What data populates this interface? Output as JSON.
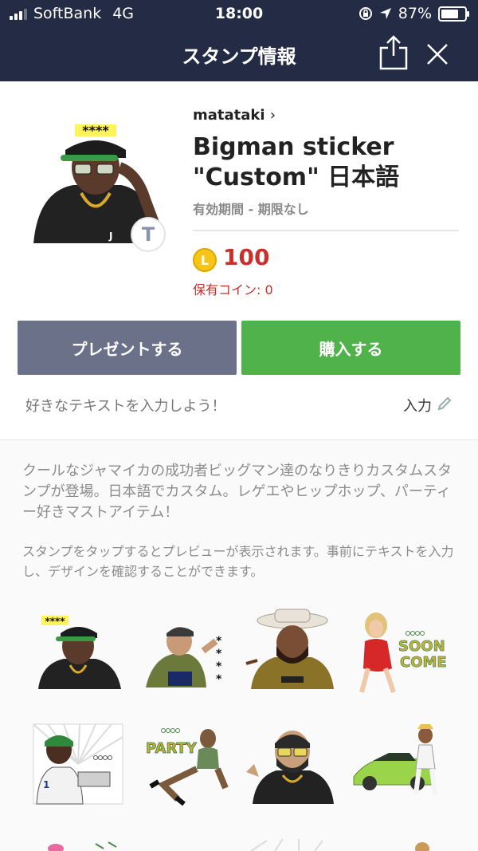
{
  "status": {
    "carrier": "SoftBank",
    "network": "4G",
    "time": "18:00",
    "battery": "87%",
    "battery_level": 0.87
  },
  "nav": {
    "title": "スタンプ情報"
  },
  "product": {
    "author": "matataki",
    "title_line1": "Bigman sticker",
    "title_line2": "\"Custom\" 日本語",
    "validity": "有効期間 - 期限なし",
    "badge": "T",
    "coin_symbol": "L",
    "price": "100",
    "owned_coins": "保有コイン: 0",
    "stars": "****"
  },
  "buttons": {
    "present": "プレゼントする",
    "buy": "購入する"
  },
  "custom_input": {
    "placeholder": "好きなテキストを入力しよう！",
    "action": "入力"
  },
  "description": "クールなジャマイカの成功者ビッグマン達のなりきりカスタムスタンプが登場。日本語でカスタム。レゲエやヒップホップ、パーティー好きマストアイテム！",
  "preview_note": "スタンプをタップするとプレビューが表示されます。事前にテキストを入力し、デザインを確認することができます。",
  "sticker_texts": {
    "soon_come": "SOON COME",
    "party": "PARTY",
    "stars": "****"
  },
  "colors": {
    "nav_bg": "#242b45",
    "present_btn": "#6a7189",
    "buy_btn": "#4fb24a",
    "price": "#c7302c",
    "coin": "#f5c518"
  }
}
